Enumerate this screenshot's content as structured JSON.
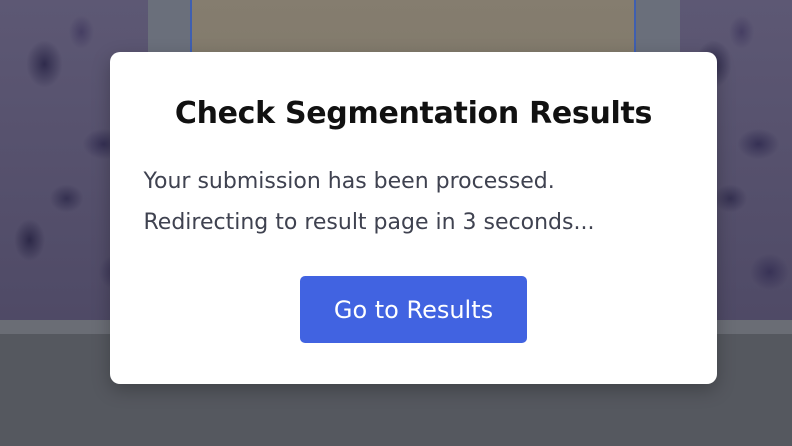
{
  "modal": {
    "title": "Check Segmentation Results",
    "message_line1": "Your submission has been processed.",
    "message_line2": "Redirecting to result page in 3 seconds...",
    "button_label": "Go to Results"
  },
  "colors": {
    "button_background": "#4163e1",
    "overlay": "#55585f",
    "modal_background": "#ffffff"
  }
}
